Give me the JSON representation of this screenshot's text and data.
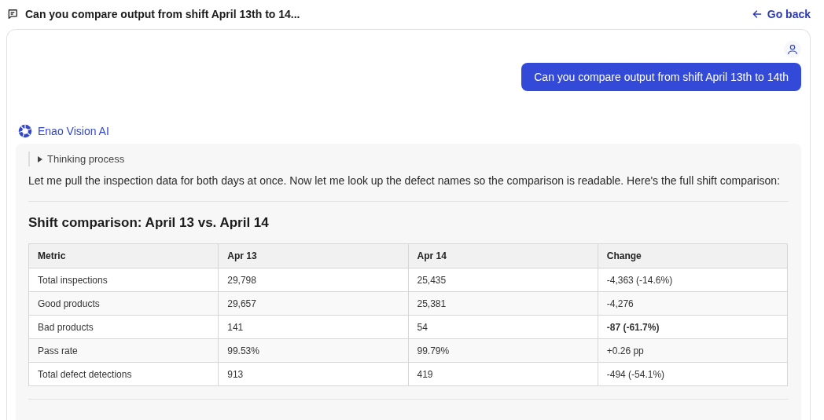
{
  "header": {
    "title": "Can you compare output from shift April 13th to 14...",
    "back_link": "Go back"
  },
  "user_message": {
    "text": "Can you compare output from shift April 13th to 14th"
  },
  "assistant": {
    "name": "Enao Vision AI",
    "thinking": {
      "label": "Thinking process",
      "expanded": false
    },
    "intro": "Let me pull the inspection data for both days at once. Now let me look up the defect names so the comparison is readable. Here's the full shift comparison:",
    "heading": "Shift comparison: April 13 vs. April 14",
    "table": {
      "columns": [
        "Metric",
        "Apr 13",
        "Apr 14",
        "Change"
      ],
      "rows": [
        {
          "cells": [
            "Total inspections",
            "29,798",
            "25,435",
            "-4,363 (-14.6%)"
          ],
          "change_bold": false
        },
        {
          "cells": [
            "Good products",
            "29,657",
            "25,381",
            "-4,276"
          ],
          "change_bold": false
        },
        {
          "cells": [
            "Bad products",
            "141",
            "54",
            "-87 (-61.7%)"
          ],
          "change_bold": true
        },
        {
          "cells": [
            "Pass rate",
            "99.53%",
            "99.79%",
            "+0.26 pp"
          ],
          "change_bold": false
        },
        {
          "cells": [
            "Total defect detections",
            "913",
            "419",
            "-494 (-54.1%)"
          ],
          "change_bold": false
        }
      ]
    }
  }
}
